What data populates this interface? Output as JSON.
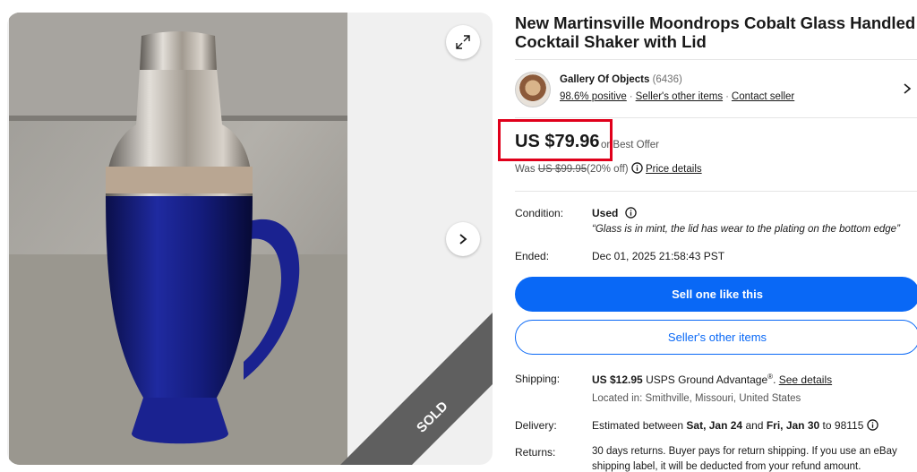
{
  "listing": {
    "title": "New Martinsville Moondrops Cobalt Glass Handled Cocktail Shaker with Lid",
    "sold_label": "SOLD"
  },
  "seller": {
    "name": "Gallery Of Objects",
    "feedback_count": "(6436)",
    "positive": "98.6% positive",
    "other_items_link": "Seller's other items",
    "contact_link": "Contact seller",
    "separator": "·"
  },
  "price": {
    "amount": "US $79.96",
    "offer_text": "or Best Offer",
    "was_label": "Was",
    "was_amount": "US $99.95",
    "discount": "(20% off)",
    "details_link": "Price details"
  },
  "condition": {
    "label": "Condition:",
    "value": "Used",
    "note": "“Glass is in mint, the lid has wear to the plating on the bottom edge”"
  },
  "ended": {
    "label": "Ended:",
    "value": "Dec 01, 2025 21:58:43 PST"
  },
  "buttons": {
    "sell_one": "Sell one like this",
    "other_items": "Seller's other items"
  },
  "shipping": {
    "label": "Shipping:",
    "cost": "US $12.95",
    "service": "USPS Ground Advantage",
    "reg": "®",
    "details_link": "See details",
    "location": "Located in: Smithville, Missouri, United States"
  },
  "delivery": {
    "label": "Delivery:",
    "prefix": "Estimated between",
    "start": "Sat, Jan 24",
    "and": "and",
    "end": "Fri, Jan 30",
    "to": "to 98115"
  },
  "returns": {
    "label": "Returns:",
    "line1": "30 days returns. Buyer pays for return shipping. If you use an eBay",
    "line2": "shipping label, it will be deducted from your refund amount."
  },
  "icons": {
    "expand": "expand-icon",
    "next": "chevron-right-icon",
    "info": "info-icon"
  },
  "colors": {
    "primary": "#0968f6",
    "highlight": "#e0001b",
    "sold_ribbon": "#5f5f5f"
  }
}
